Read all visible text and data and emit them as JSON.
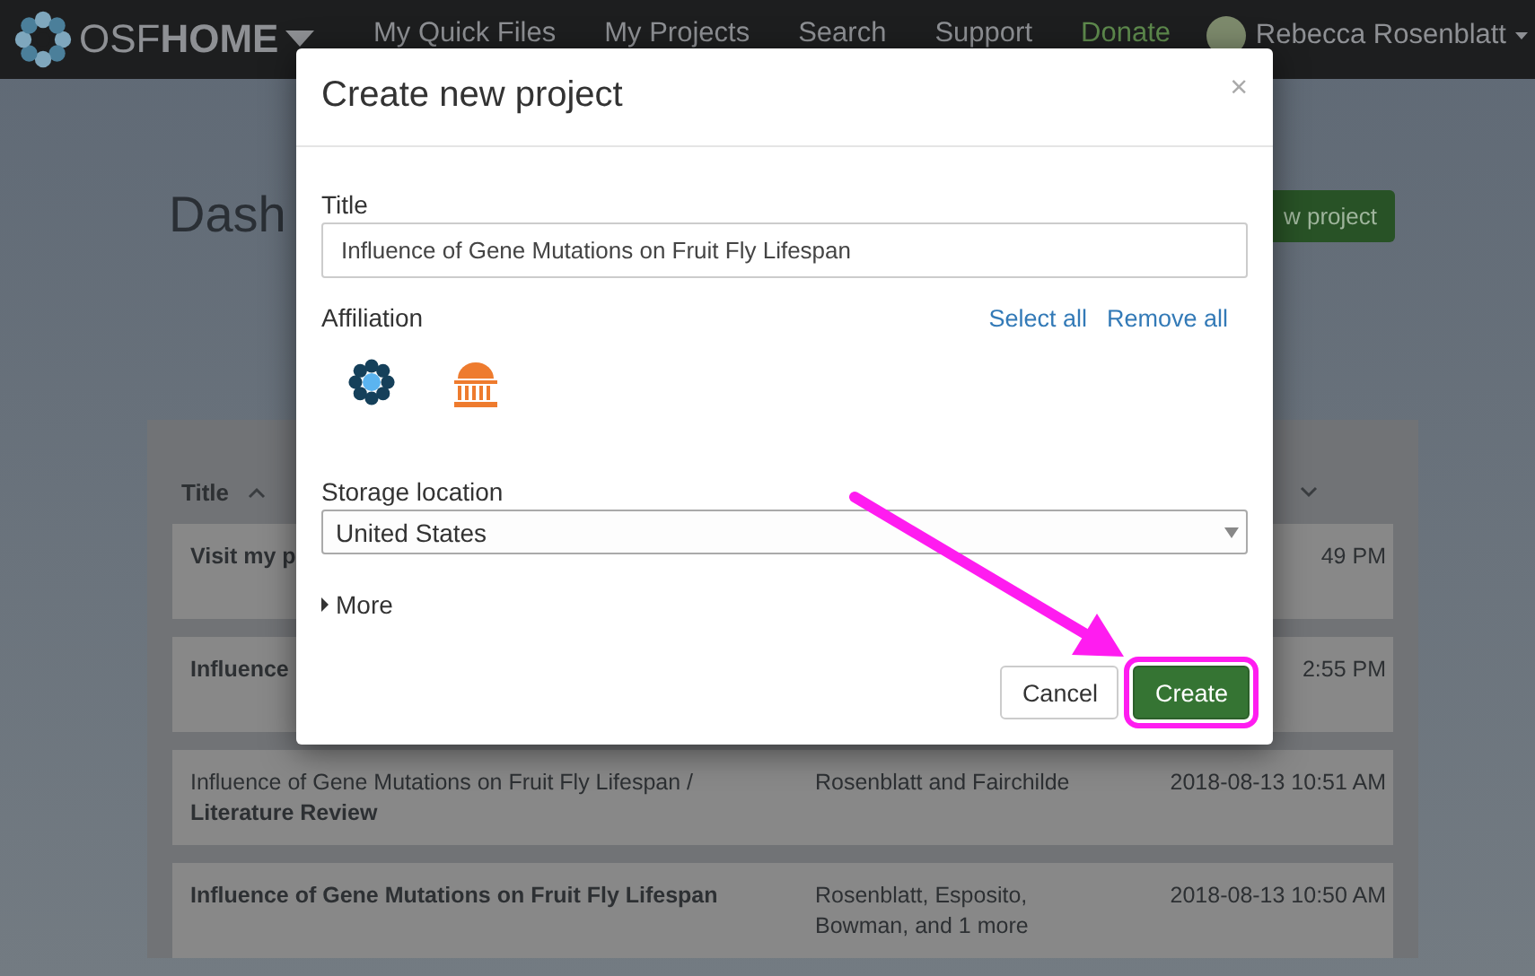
{
  "navbar": {
    "brand_light": "OSF",
    "brand_bold": "HOME",
    "links": [
      {
        "label": "My Quick Files",
        "kind": "link"
      },
      {
        "label": "My Projects",
        "kind": "link"
      },
      {
        "label": "Search",
        "kind": "link"
      },
      {
        "label": "Support",
        "kind": "link"
      },
      {
        "label": "Donate",
        "kind": "donate"
      }
    ],
    "user": "Rebecca Rosenblatt"
  },
  "dashboard": {
    "heading": "Dash",
    "new_project_button": "w project",
    "table": {
      "title_column": "Title",
      "rows": [
        {
          "kind": "project",
          "title": "Visit my p",
          "date": "49 PM"
        },
        {
          "kind": "project",
          "title": "Influence",
          "date": "2:55 PM"
        },
        {
          "kind": "component",
          "title": "Influence of Gene Mutations on Fruit Fly Lifespan / **Literature Review**",
          "contributors": "Rosenblatt and Fairchilde",
          "date": "2018-08-13 10:51 AM"
        },
        {
          "kind": "project",
          "title": "Influence of Gene Mutations on Fruit Fly Lifespan",
          "contributors": "Rosenblatt, Esposito, Bowman, and 1 more",
          "date": "2018-08-13 10:50 AM"
        }
      ]
    }
  },
  "modal": {
    "title": "Create new project",
    "close": "×",
    "title_label": "Title",
    "title_value": "Influence of Gene Mutations on Fruit Fly Lifespan",
    "affiliation_label": "Affiliation",
    "select_all": "Select all",
    "remove_all": "Remove all",
    "storage_label": "Storage location",
    "storage_value": "United States",
    "more": "More",
    "cancel": "Cancel",
    "create": "Create"
  }
}
